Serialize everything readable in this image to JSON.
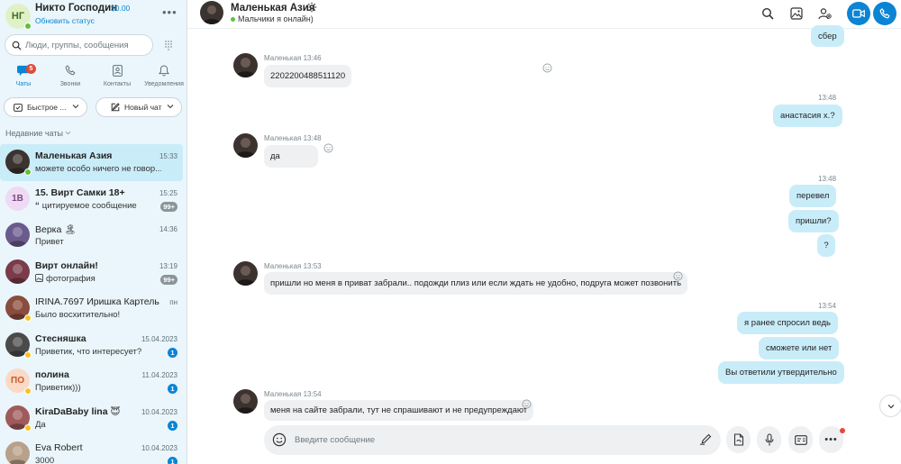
{
  "user": {
    "initials": "НГ",
    "name": "Никто Господин",
    "balance": "$0.00",
    "status_link": "Обновить статус"
  },
  "search": {
    "placeholder": "Люди, группы, сообщения"
  },
  "nav_tabs": [
    {
      "label": "Чаты",
      "badge": "5",
      "icon": "chat-icon",
      "active": true
    },
    {
      "label": "Звонки",
      "icon": "phone-icon"
    },
    {
      "label": "Контакты",
      "icon": "contacts-icon"
    },
    {
      "label": "Уведомления",
      "icon": "bell-icon"
    }
  ],
  "buttons": {
    "quick": "Быстрое ...",
    "new_chat": "Новый чат"
  },
  "recent_label": "Недавние чаты",
  "chats": [
    {
      "title": "Маленькая Азия",
      "preview": "можете особо ничего не говор...",
      "time": "15:33",
      "bold": true,
      "selected": true,
      "presence": "green",
      "avatar_color": "#3a3330"
    },
    {
      "title": "15. Вирт Самки 18+",
      "preview": "цитируемое сообщение",
      "preview_icon": "quote-icon",
      "time": "15:25",
      "count": "99+",
      "count_grey": true,
      "bold": true,
      "avatar_initials": "1В",
      "avatar_color": "#efd9f3"
    },
    {
      "title": "Верка",
      "title_emoji": "🏝",
      "preview": "Привет",
      "time": "14:36",
      "avatar_color": "#6b5a8c"
    },
    {
      "title": "Вирт онлайн!",
      "preview": "фотография",
      "preview_icon": "image-icon",
      "time": "13:19",
      "count": "99+",
      "count_grey": true,
      "bold": true,
      "avatar_color": "#7b3b4a"
    },
    {
      "title": "IRINA.7697 Иришка Картель",
      "preview": "Было восхитительно!",
      "time": "пн",
      "presence": "yellow",
      "avatar_color": "#8a4c3d"
    },
    {
      "title": "Стесняшка",
      "preview": "Приветик, что интересует?",
      "time": "15.04.2023",
      "count": "1",
      "bold": true,
      "presence": "yellow",
      "avatar_color": "#4a4a4a"
    },
    {
      "title": "полина",
      "preview": "Приветик)))",
      "time": "11.04.2023",
      "count": "1",
      "bold": true,
      "presence": "yellow",
      "avatar_initials": "ПО",
      "avatar_color": "#fbd9c4"
    },
    {
      "title": "KiraDaBaby lina",
      "title_emoji": "😇",
      "preview": "Да",
      "time": "10.04.2023",
      "count": "1",
      "bold": true,
      "presence": "yellow",
      "avatar_color": "#a05a5a"
    },
    {
      "title": "Eva Robert",
      "preview": "3000",
      "time": "10.04.2023",
      "count": "1",
      "avatar_color": "#b8a08a"
    }
  ],
  "conversation": {
    "name": "Маленькая Азия",
    "mood": "Мальчики я онлайн)",
    "composer_placeholder": "Введите сообщение",
    "messages": [
      {
        "dir": "out",
        "text": "сбер"
      },
      {
        "dir": "in",
        "meta": "Маленькая 13:46",
        "text": "2202200488511120"
      },
      {
        "dir": "out",
        "time": "13:48",
        "text": "анастасия х.?"
      },
      {
        "dir": "in",
        "meta": "Маленькая 13:48",
        "text": "да"
      },
      {
        "dir": "out",
        "time": "13:48",
        "text": "перевел"
      },
      {
        "dir": "out",
        "text": "пришли?"
      },
      {
        "dir": "out",
        "text": "?"
      },
      {
        "dir": "in",
        "meta": "Маленькая 13:53",
        "text": "пришли но меня в приват забрали.. подожди плиз или если ждать не удобно, подруга может позвонить"
      },
      {
        "dir": "out",
        "time": "13:54",
        "text": "я ранее спросил ведь"
      },
      {
        "dir": "out",
        "text": "сможете или нет"
      },
      {
        "dir": "out",
        "text": "Вы ответили утвердительно"
      },
      {
        "dir": "in",
        "meta": "Маленькая 13:54",
        "text": "меня на сайте забрали, тут не спрашивают и не предупреждают"
      }
    ]
  },
  "colors": {
    "accent": "#0b84d4",
    "sidebar_bg": "#eaf6fb",
    "out_bubble": "#c9ecf9",
    "in_bubble": "#eef0f2",
    "online": "#5ec23a",
    "away": "#f8c21f"
  }
}
